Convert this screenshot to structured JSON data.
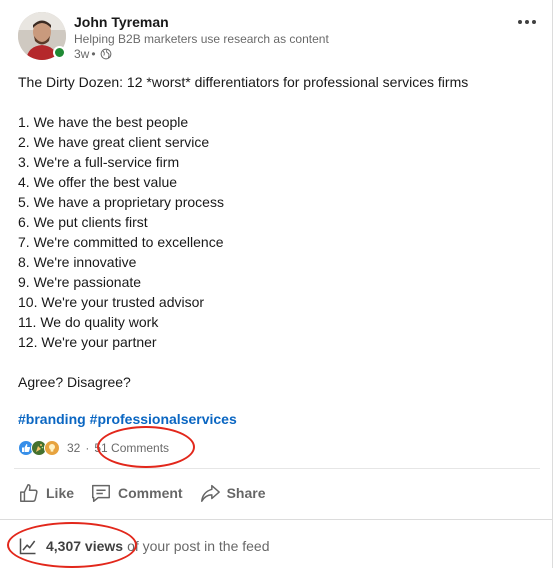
{
  "post": {
    "author": {
      "name": "John Tyreman",
      "headline": "Helping B2B marketers use research as content",
      "time": "3w",
      "meta_separator": "•",
      "visibility_icon": "globe-icon",
      "online_color": "#1f8a34"
    },
    "more_icon": "more-horizontal-icon",
    "title": "The Dirty Dozen: 12 *worst* differentiators for professional services firms",
    "list": [
      "1. We have the best people",
      "2. We have great client service",
      "3. We're a full-service firm",
      "4. We offer the best value",
      "5. We have a proprietary process",
      "6. We put clients first",
      "7. We're committed to excellence",
      "8. We're innovative",
      "9. We're passionate",
      "10. We're your trusted advisor",
      "11. We do quality work",
      "12. We're your partner"
    ],
    "closing": "Agree? Disagree?",
    "hashtags": [
      "#branding",
      "#professionalservices"
    ]
  },
  "social": {
    "reactions": [
      "like-reaction-icon",
      "celebrate-reaction-icon",
      "insightful-reaction-icon"
    ],
    "reaction_count": "32",
    "separator": "·",
    "comments": "51 Comments"
  },
  "actions": {
    "like": "Like",
    "comment": "Comment",
    "share": "Share"
  },
  "views": {
    "icon": "trend-chart-icon",
    "count": "4,307 views",
    "suffix": "of your post in the feed"
  },
  "colors": {
    "link": "#0a66c2",
    "annotation": "#e2271b",
    "like": "#378fe9",
    "celebrate": "#44712e",
    "insightful": "#e7a33e"
  }
}
